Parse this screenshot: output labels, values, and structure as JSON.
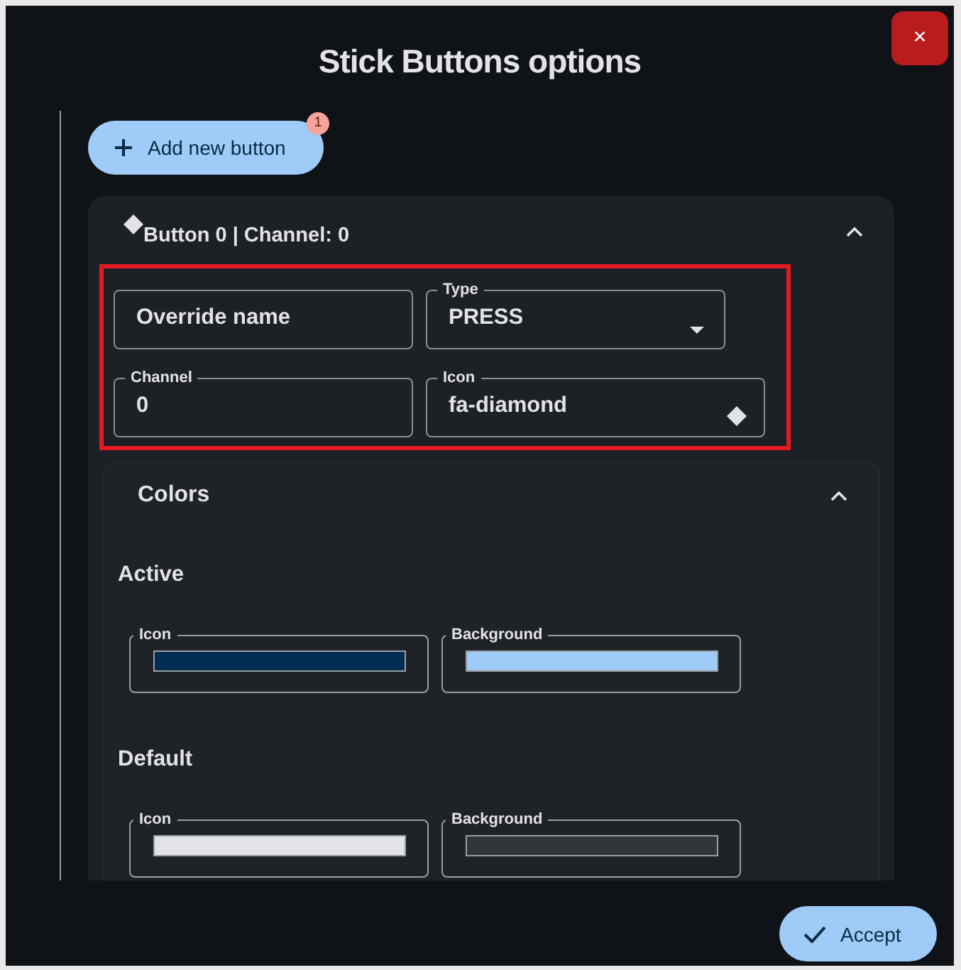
{
  "dialog": {
    "title": "Stick Buttons options",
    "close": "×"
  },
  "add_button": {
    "label": "Add new button",
    "badge": "1"
  },
  "button_card": {
    "title": "Button 0 | Channel: 0",
    "expanded": true,
    "highlighted": true,
    "field_rows": [
      {
        "fields": [
          {
            "value": "Override name",
            "kind": "text"
          },
          {
            "label": "Type",
            "value": "PRESS",
            "kind": "select"
          }
        ]
      },
      {
        "fields": [
          {
            "label": "Channel",
            "value": "0",
            "kind": "text"
          },
          {
            "label": "Icon",
            "value": "fa-diamond",
            "kind": "icon"
          }
        ]
      }
    ],
    "colors": {
      "title": "Colors",
      "expanded": true,
      "groups": [
        {
          "title": "Active",
          "swatches": [
            {
              "label": "Icon",
              "color": "#002e52"
            },
            {
              "label": "Background",
              "color": "#9ecbf7"
            }
          ]
        },
        {
          "title": "Default",
          "swatches": [
            {
              "label": "Icon",
              "color": "#e2e3e6"
            },
            {
              "label": "Background",
              "color": "#32363b"
            }
          ]
        }
      ]
    }
  },
  "accept": {
    "label": "Accept"
  }
}
